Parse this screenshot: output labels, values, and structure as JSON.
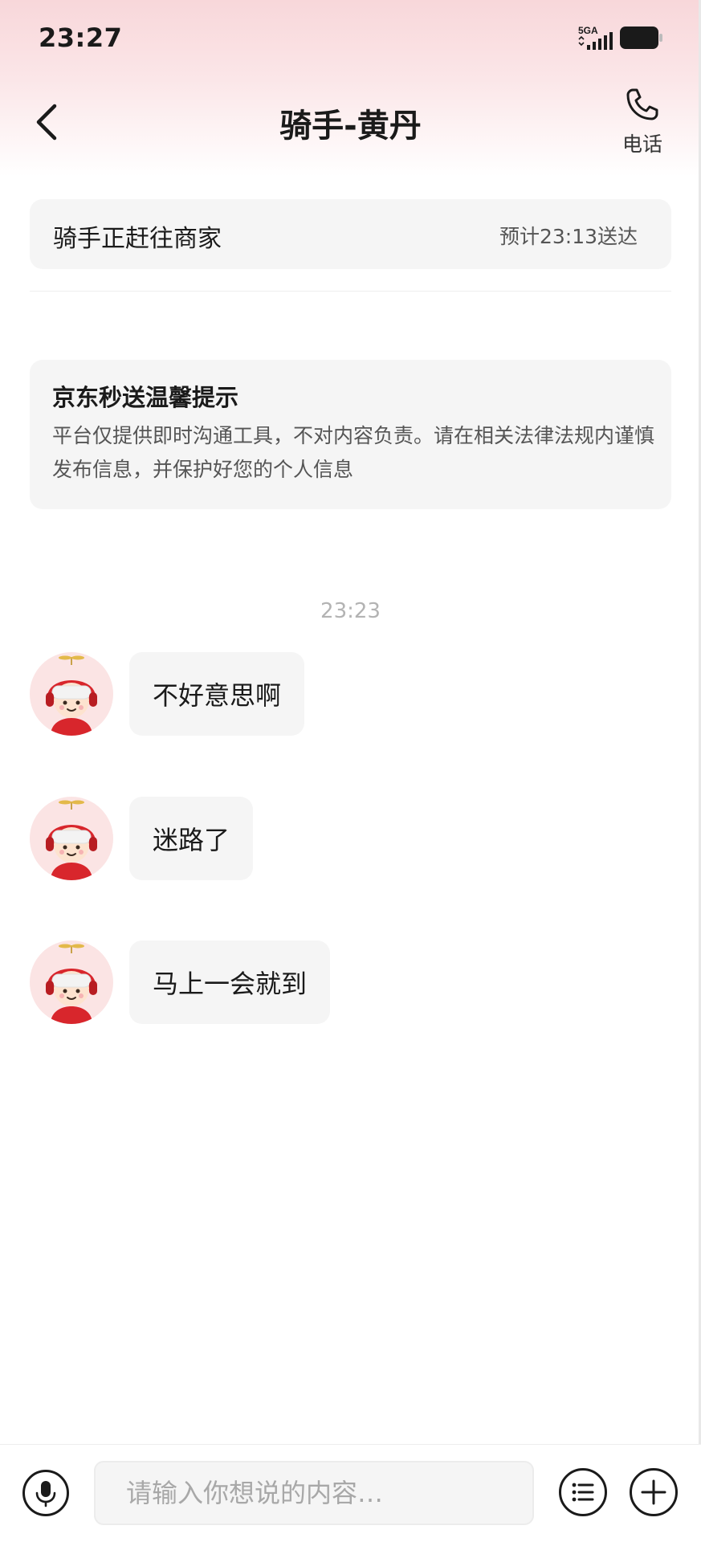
{
  "status_bar": {
    "time": "23:27",
    "network": "5GA",
    "signal_icon": "signal-icon",
    "battery_icon": "battery-icon"
  },
  "nav": {
    "back_icon": "chevron-left-icon",
    "title": "骑手-黄丹",
    "phone_icon": "phone-icon",
    "phone_label": "电话"
  },
  "delivery_status": {
    "text": "骑手正赶往商家",
    "eta": "预计23:13送达"
  },
  "notice": {
    "title": "京东秒送温馨提示",
    "body": "平台仅提供即时沟通工具，不对内容负责。请在相关法律法规内谨慎发布信息，并保护好您的个人信息"
  },
  "chat": {
    "timestamp": "23:23",
    "messages": [
      {
        "sender": "rider",
        "avatar_icon": "rider-avatar-icon",
        "text": "不好意思啊"
      },
      {
        "sender": "rider",
        "avatar_icon": "rider-avatar-icon",
        "text": "迷路了"
      },
      {
        "sender": "rider",
        "avatar_icon": "rider-avatar-icon",
        "text": "马上一会就到"
      }
    ]
  },
  "input_bar": {
    "voice_icon": "microphone-icon",
    "placeholder": "请输入你想说的内容…",
    "value": "",
    "quick_reply_icon": "list-icon",
    "more_icon": "plus-icon"
  },
  "colors": {
    "header_gradient_top": "#f8d7da",
    "card_background": "#f5f5f5",
    "timestamp_text": "#b3b3b3",
    "avatar_red": "#d8262c"
  }
}
